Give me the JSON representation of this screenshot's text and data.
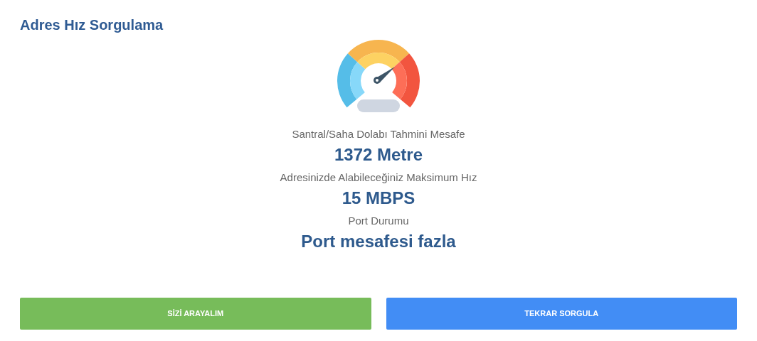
{
  "title": "Adres Hız Sorgulama",
  "results": [
    {
      "label": "Santral/Saha Dolabı Tahmini Mesafe",
      "value": "1372 Metre"
    },
    {
      "label": "Adresinizde Alabileceğiniz Maksimum Hız",
      "value": "15 MBPS"
    },
    {
      "label": "Port Durumu",
      "value": "Port mesafesi fazla"
    }
  ],
  "buttons": [
    {
      "label": "SİZİ ARAYALIM",
      "kind": "success"
    },
    {
      "label": "TEKRAR SORGULA",
      "kind": "primary"
    }
  ]
}
